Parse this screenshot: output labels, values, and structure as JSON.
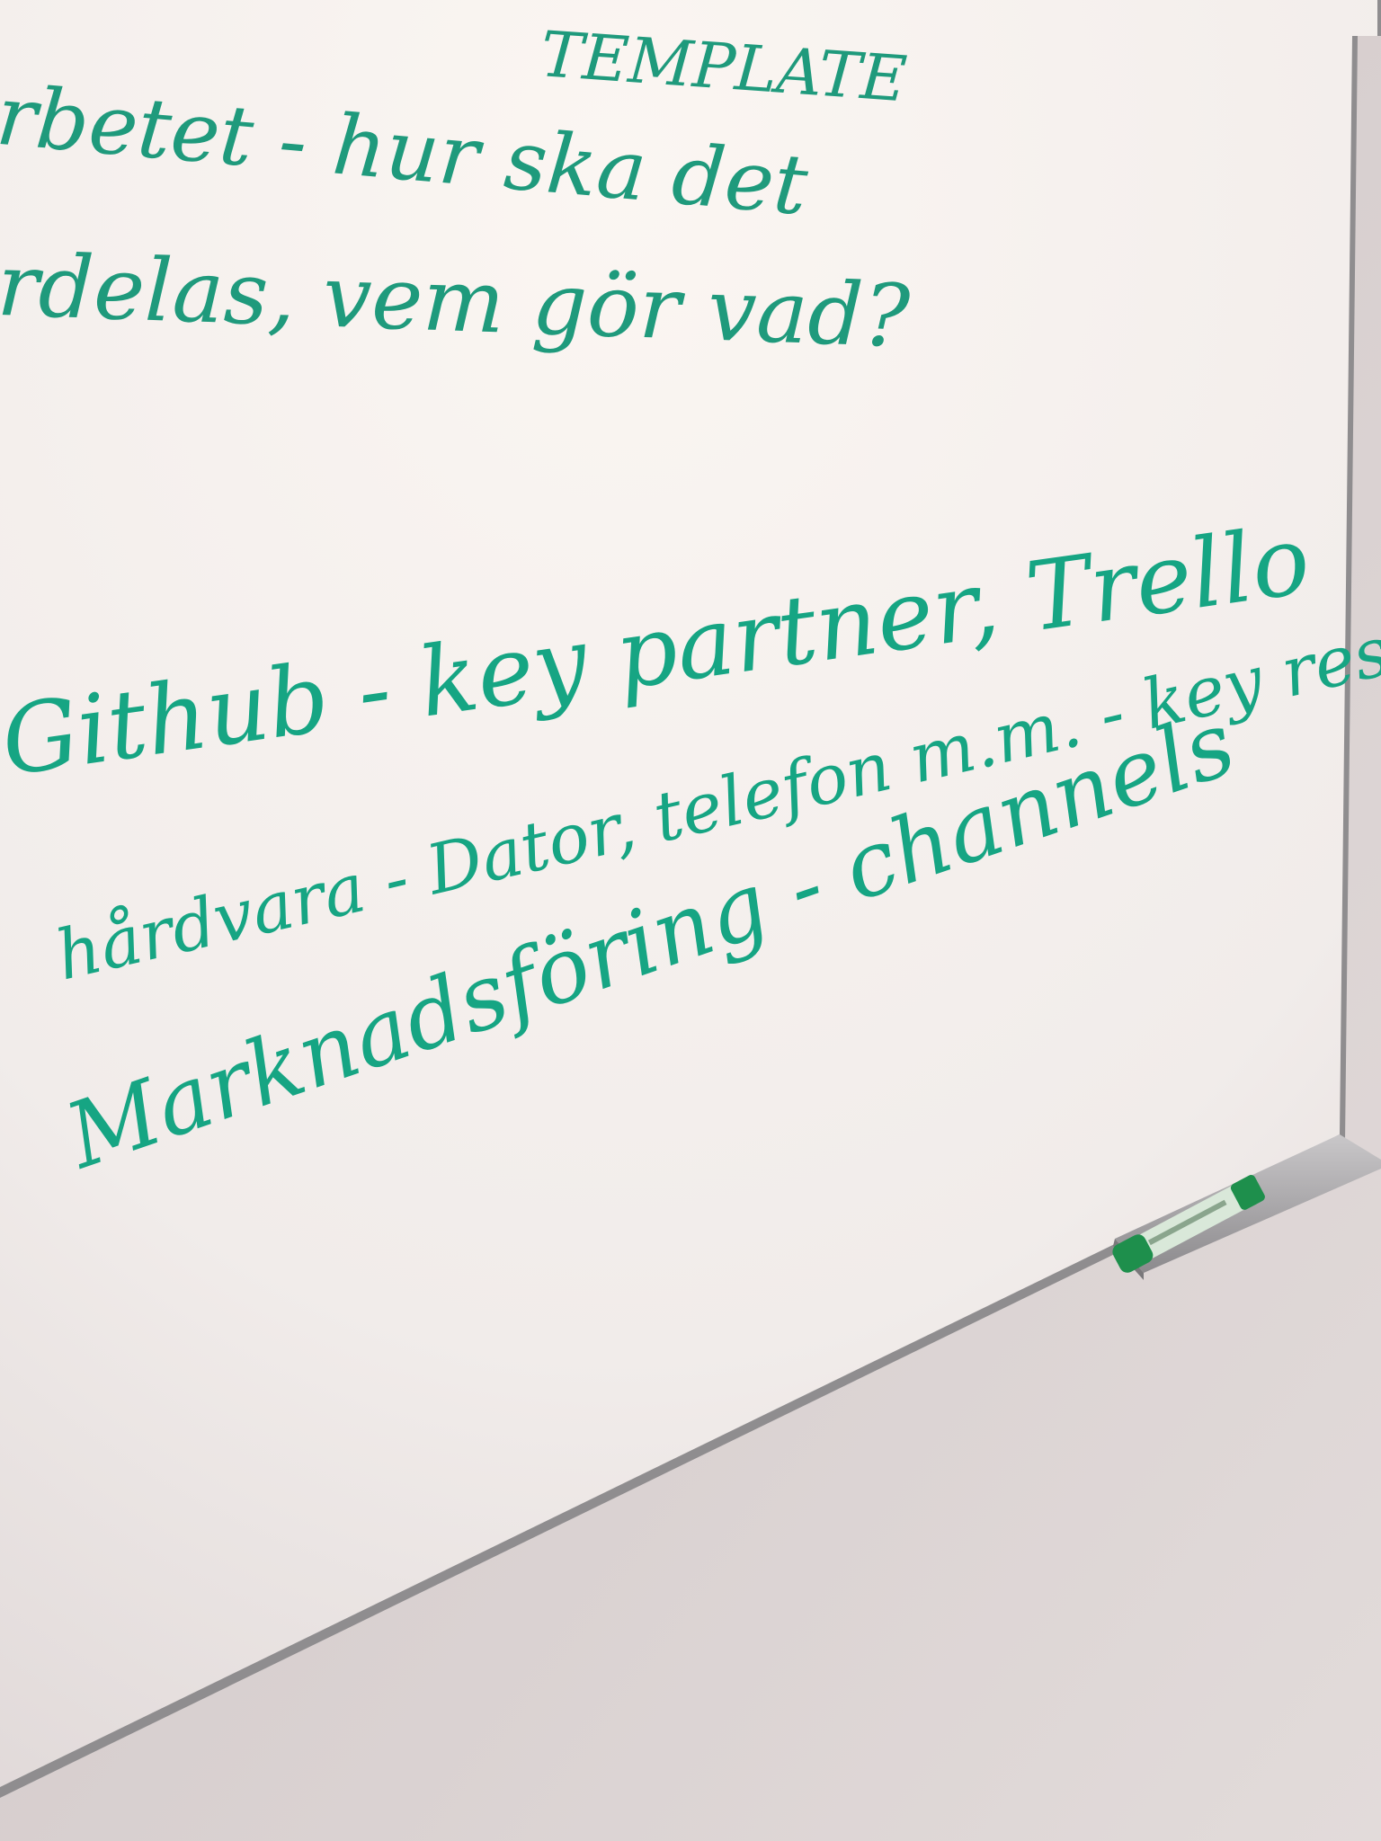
{
  "whiteboard": {
    "lines": [
      "TEMPLATE",
      "rbetet - hur ska det",
      "rdelas, vem gör vad?",
      "Github - key partner, Trello",
      "hårdvara - Dator, telefon m.m. - key resources",
      "Marknadsföring - channels"
    ]
  },
  "colors": {
    "ink": "#1f9a7c",
    "board": "#f2eeec",
    "wall": "#d8cfcf",
    "frame": "#8f8d8f",
    "marker_body": "#1e8f4c",
    "marker_label": "#d9e8d9"
  },
  "marker": {
    "icon": "whiteboard-marker-icon"
  }
}
